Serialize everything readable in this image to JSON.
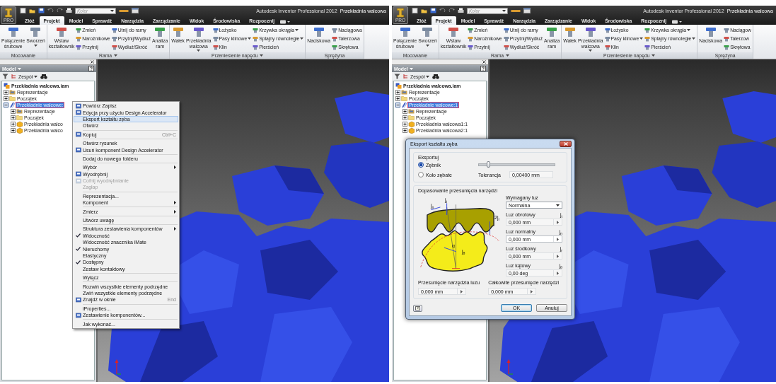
{
  "screens": [
    {
      "title_bar": {
        "app_badge": "PRO",
        "color_placeholder": "Kolor",
        "product": "Autodesk Inventor Professional 2012",
        "document": "Przekładnia walcowa"
      },
      "tabs": [
        {
          "label": "Złóż",
          "selected": false
        },
        {
          "label": "Projekt",
          "selected": true
        },
        {
          "label": "Model",
          "selected": false
        },
        {
          "label": "Sprawdź",
          "selected": false
        },
        {
          "label": "Narzędzia",
          "selected": false
        },
        {
          "label": "Zarządzanie",
          "selected": false
        },
        {
          "label": "Widok",
          "selected": false
        },
        {
          "label": "Środowiska",
          "selected": false
        },
        {
          "label": "Rozpocznij",
          "selected": false
        }
      ],
      "ribbon": [
        {
          "label": "Mocowanie",
          "menu": false,
          "tools": [
            {
              "kind": "large",
              "label": "Połączenie śrubowe",
              "dropdown": false
            },
            {
              "kind": "large",
              "label": "Sworzeń",
              "dropdown": true
            }
          ]
        },
        {
          "label": "Rama",
          "menu": true,
          "tools": [
            {
              "kind": "large",
              "label": "Wstaw kształtownik",
              "dropdown": false
            },
            {
              "kind": "column",
              "items": [
                {
                  "label": "Zmień",
                  "dropdown": false
                },
                {
                  "label": "Narożnikowe",
                  "dropdown": false
                },
                {
                  "label": "Przytnij",
                  "dropdown": false
                }
              ]
            },
            {
              "kind": "column",
              "items": [
                {
                  "label": "Utnij do ramy",
                  "dropdown": false
                },
                {
                  "label": "Przytnij/Wydłuż",
                  "dropdown": false
                },
                {
                  "label": "Wydłuż/Skróć",
                  "dropdown": false
                }
              ]
            },
            {
              "kind": "large",
              "label": "Analiza ram",
              "dropdown": false
            }
          ]
        },
        {
          "label": "Przeniesienie napędu",
          "menu": true,
          "tools": [
            {
              "kind": "large",
              "label": "Wałek",
              "dropdown": false
            },
            {
              "kind": "large",
              "label": "Przekładnia walcowa",
              "dropdown": true
            },
            {
              "kind": "column",
              "items": [
                {
                  "label": "Łożysko",
                  "dropdown": false
                },
                {
                  "label": "Pasy klinowe",
                  "dropdown": true
                },
                {
                  "label": "Klin",
                  "dropdown": false
                }
              ]
            },
            {
              "kind": "column",
              "items": [
                {
                  "label": "Krzywka okrągła",
                  "dropdown": true
                },
                {
                  "label": "Splajny równoległe",
                  "dropdown": true
                },
                {
                  "label": "Pierścień",
                  "dropdown": false
                }
              ]
            }
          ]
        },
        {
          "label": "Sprężyna",
          "menu": false,
          "tools": [
            {
              "kind": "large",
              "label": "Naciskowa",
              "dropdown": false
            },
            {
              "kind": "column",
              "items": [
                {
                  "label": "Naciągowa",
                  "dropdown": false
                },
                {
                  "label": "Talerzowa",
                  "dropdown": false
                },
                {
                  "label": "Skrętowa",
                  "dropdown": false
                }
              ]
            }
          ]
        }
      ],
      "browser": {
        "title": "Model",
        "filter": "Zespół",
        "tree": [
          {
            "label": "Przekładnia walcowa.iam",
            "kind": "assembly",
            "selected": false,
            "children": [
              {
                "label": "Reprezentacje",
                "kind": "representations",
                "selected": false,
                "expanded": false
              },
              {
                "label": "Początek",
                "kind": "origin",
                "selected": false,
                "expanded": false
              },
              {
                "label": "Przekładnie walcowe:",
                "kind": "gear-set",
                "selected": true,
                "expanded": true,
                "children": [
                  {
                    "label": "Reprezentacje",
                    "kind": "representations",
                    "selected": false,
                    "expanded": false
                  },
                  {
                    "label": "Początek",
                    "kind": "origin",
                    "selected": false,
                    "expanded": false
                  },
                  {
                    "label": "Przekładnia walco",
                    "kind": "part",
                    "selected": false,
                    "expanded": false
                  },
                  {
                    "label": "Przekładnia walco",
                    "kind": "part",
                    "selected": false,
                    "expanded": false
                  }
                ]
              }
            ]
          }
        ]
      },
      "context_menu": {
        "groups": [
          [
            {
              "label": "Powtórz Zapisz",
              "icon": true,
              "checked": false,
              "disabled": false,
              "selected": false,
              "submenu": false
            },
            {
              "label": "Edycja przy użyciu Design Accelerator",
              "icon": true,
              "checked": false,
              "disabled": false,
              "selected": false,
              "submenu": false
            },
            {
              "label": "Eksport kształtu zęba",
              "icon": false,
              "checked": false,
              "disabled": false,
              "selected": true,
              "submenu": false
            },
            {
              "label": "Otwórz",
              "icon": false,
              "checked": false,
              "disabled": false,
              "selected": false,
              "submenu": false
            }
          ],
          [
            {
              "label": "Kopiuj",
              "shortcut": "Ctrl+C",
              "icon": true,
              "checked": false,
              "disabled": false,
              "selected": false,
              "submenu": false
            }
          ],
          [
            {
              "label": "Otwórz rysunek",
              "icon": false,
              "checked": false,
              "disabled": false,
              "selected": false,
              "submenu": false
            },
            {
              "label": "Usuń komponent Design Accelerator",
              "icon": true,
              "checked": false,
              "disabled": false,
              "selected": false,
              "submenu": false
            }
          ],
          [
            {
              "label": "Dodaj do nowego folderu",
              "icon": false,
              "checked": false,
              "disabled": false,
              "selected": false,
              "submenu": false
            }
          ],
          [
            {
              "label": "Wybór",
              "icon": false,
              "checked": false,
              "disabled": false,
              "selected": false,
              "submenu": true
            },
            {
              "label": "Wyodrębnij",
              "icon": true,
              "checked": false,
              "disabled": false,
              "selected": false,
              "submenu": false
            },
            {
              "label": "Cofnij wyodrębnianie",
              "icon": true,
              "checked": false,
              "disabled": true,
              "selected": false,
              "submenu": false
            },
            {
              "label": "Zagłap",
              "icon": false,
              "checked": false,
              "disabled": true,
              "selected": false,
              "submenu": false
            }
          ],
          [
            {
              "label": "Reprezentacja...",
              "icon": false,
              "checked": false,
              "disabled": false,
              "selected": false,
              "submenu": false
            },
            {
              "label": "Komponent",
              "icon": false,
              "checked": false,
              "disabled": false,
              "selected": false,
              "submenu": true
            }
          ],
          [
            {
              "label": "Zmierz",
              "icon": false,
              "checked": false,
              "disabled": false,
              "selected": false,
              "submenu": true
            }
          ],
          [
            {
              "label": "Utwórz uwagę",
              "icon": false,
              "checked": false,
              "disabled": false,
              "selected": false,
              "submenu": false
            }
          ],
          [
            {
              "label": "Struktura zestawienia komponentów",
              "icon": false,
              "checked": false,
              "disabled": false,
              "selected": false,
              "submenu": true
            },
            {
              "label": "Widoczność",
              "icon": false,
              "checked": true,
              "disabled": false,
              "selected": false,
              "submenu": false
            },
            {
              "label": "Widoczność znacznika iMate",
              "icon": false,
              "checked": false,
              "disabled": false,
              "selected": false,
              "submenu": false
            },
            {
              "label": "Nieruchomy",
              "icon": false,
              "checked": true,
              "disabled": false,
              "selected": false,
              "submenu": false
            },
            {
              "label": "Elastyczny",
              "icon": false,
              "checked": false,
              "disabled": false,
              "selected": false,
              "submenu": false
            },
            {
              "label": "Dostępny",
              "icon": false,
              "checked": true,
              "disabled": false,
              "selected": false,
              "submenu": false
            },
            {
              "label": "Zestaw kontaktowy",
              "icon": false,
              "checked": false,
              "disabled": false,
              "selected": false,
              "submenu": false
            }
          ],
          [
            {
              "label": "Wyłącz",
              "icon": false,
              "checked": false,
              "disabled": false,
              "selected": false,
              "submenu": false
            }
          ],
          [
            {
              "label": "Rozwiń wszystkie elementy podrzędne",
              "icon": false,
              "checked": false,
              "disabled": false,
              "selected": false,
              "submenu": false
            },
            {
              "label": "Zwiń wszystkie elementy podrzędne",
              "icon": false,
              "checked": false,
              "disabled": false,
              "selected": false,
              "submenu": false
            },
            {
              "label": "Znajdź w oknie",
              "shortcut": "End",
              "icon": true,
              "checked": false,
              "disabled": false,
              "selected": false,
              "submenu": false
            }
          ],
          [
            {
              "label": "iProperties...",
              "icon": false,
              "checked": false,
              "disabled": false,
              "selected": false,
              "submenu": false
            },
            {
              "label": "Zestawienie komponentów...",
              "icon": true,
              "checked": false,
              "disabled": false,
              "selected": false,
              "submenu": false
            }
          ],
          [
            {
              "label": "Jak wykonać...",
              "icon": false,
              "checked": false,
              "disabled": false,
              "selected": false,
              "submenu": false
            }
          ]
        ]
      }
    },
    {
      "title_bar": {
        "app_badge": "PRO",
        "color_placeholder": "Kolor",
        "product": "Autodesk Inventor Professional 2012",
        "document": "Przekładnia walcowa"
      },
      "tabs": [
        {
          "label": "Złóż",
          "selected": false
        },
        {
          "label": "Projekt",
          "selected": true
        },
        {
          "label": "Model",
          "selected": false
        },
        {
          "label": "Sprawdź",
          "selected": false
        },
        {
          "label": "Narzędzia",
          "selected": false
        },
        {
          "label": "Zarządzanie",
          "selected": false
        },
        {
          "label": "Widok",
          "selected": false
        },
        {
          "label": "Środowiska",
          "selected": false
        },
        {
          "label": "Rozpocznij",
          "selected": false
        }
      ],
      "ribbon": [
        {
          "label": "Mocowanie",
          "menu": false,
          "tools": [
            {
              "kind": "large",
              "label": "Połączenie śrubowe",
              "dropdown": false
            },
            {
              "kind": "large",
              "label": "Sworzeń",
              "dropdown": true
            }
          ]
        },
        {
          "label": "Rama",
          "menu": true,
          "tools": [
            {
              "kind": "large",
              "label": "Wstaw kształtownik",
              "dropdown": false
            },
            {
              "kind": "column",
              "items": [
                {
                  "label": "Zmień",
                  "dropdown": false
                },
                {
                  "label": "Narożnikowe",
                  "dropdown": false
                },
                {
                  "label": "Przytnij",
                  "dropdown": false
                }
              ]
            },
            {
              "kind": "column",
              "items": [
                {
                  "label": "Utnij do ramy",
                  "dropdown": false
                },
                {
                  "label": "Przytnij/Wydłuż",
                  "dropdown": false
                },
                {
                  "label": "Wydłuż/Skróć",
                  "dropdown": false
                }
              ]
            },
            {
              "kind": "large",
              "label": "Analiza ram",
              "dropdown": false
            }
          ]
        },
        {
          "label": "Przeniesienie napędu",
          "menu": true,
          "tools": [
            {
              "kind": "large",
              "label": "Wałek",
              "dropdown": false
            },
            {
              "kind": "large",
              "label": "Przekładnia walcowa",
              "dropdown": true
            },
            {
              "kind": "column",
              "items": [
                {
                  "label": "Łożysko",
                  "dropdown": false
                },
                {
                  "label": "Pasy klinowe",
                  "dropdown": true
                },
                {
                  "label": "Klin",
                  "dropdown": false
                }
              ]
            },
            {
              "kind": "column",
              "items": [
                {
                  "label": "Krzywka okrągła",
                  "dropdown": true
                },
                {
                  "label": "Splajny równoległe",
                  "dropdown": true
                },
                {
                  "label": "Pierścień",
                  "dropdown": false
                }
              ]
            }
          ]
        },
        {
          "label": "Sprężyna",
          "menu": false,
          "tools": [
            {
              "kind": "large",
              "label": "Naciskowa",
              "dropdown": false
            },
            {
              "kind": "column",
              "items": [
                {
                  "label": "Naciągow",
                  "dropdown": false
                },
                {
                  "label": "Talerzow",
                  "dropdown": false
                },
                {
                  "label": "Skrętowa",
                  "dropdown": false
                }
              ]
            }
          ]
        }
      ],
      "browser": {
        "title": "Model",
        "filter": "Zespół",
        "tree": [
          {
            "label": "Przekładnia walcowa.iam",
            "kind": "assembly",
            "selected": false,
            "children": [
              {
                "label": "Reprezentacje",
                "kind": "representations",
                "selected": false,
                "expanded": false
              },
              {
                "label": "Początek",
                "kind": "origin",
                "selected": false,
                "expanded": false
              },
              {
                "label": "Przekładnie walcowe:1",
                "kind": "gear-set",
                "selected": true,
                "expanded": true,
                "children": [
                  {
                    "label": "Reprezentacje",
                    "kind": "representations",
                    "selected": false,
                    "expanded": false
                  },
                  {
                    "label": "Początek",
                    "kind": "origin",
                    "selected": false,
                    "expanded": false
                  },
                  {
                    "label": "Przekładnia walcowa1:1",
                    "kind": "part",
                    "selected": false,
                    "expanded": false
                  },
                  {
                    "label": "Przekładnia walcowa2:1",
                    "kind": "part",
                    "selected": false,
                    "expanded": false
                  }
                ]
              }
            ]
          }
        ]
      },
      "dialog": {
        "title": "Eksport kształtu zęba",
        "export": {
          "label": "Eksportuj",
          "options": [
            {
              "label": "Zębnik",
              "selected": true
            },
            {
              "label": "Koło zębate",
              "selected": false
            }
          ],
          "slider": {
            "level": 0.12
          },
          "tolerance": {
            "label": "Tolerancja",
            "value": "0,00400 mm"
          }
        },
        "fit": {
          "label": "Dopasowanie przesunięcia narzędzi",
          "diagram_labels": [
            "j$_{n}$",
            "j$_{t}$",
            "2j$_{r}$",
            "α",
            "j$_{θ}$"
          ],
          "required": {
            "label": "Wymagany luz",
            "value": "Normalna"
          },
          "fields": [
            {
              "label": "Luz obrotowy",
              "symbol": "j$_{t}$",
              "value": "0,000 mm",
              "disabled": true
            },
            {
              "label": "Luz normalny",
              "symbol": "j$_{n}$",
              "value": "0,000 mm",
              "disabled": false
            },
            {
              "label": "Luz środkowy",
              "symbol": "j$_{r}$",
              "value": "0,000 mm",
              "disabled": true
            },
            {
              "label": "Luz kątowy",
              "symbol": "j$_{θ}$",
              "value": "0,00 deg",
              "disabled": true
            }
          ],
          "tool_shift": {
            "label": "Przesunięcie narzędzia luzu",
            "value": "0,000 mm",
            "disabled": true
          },
          "total_shift": {
            "label": "Całkowite przesunięcie narzędzi",
            "value": "0,000 mm",
            "disabled": true
          }
        },
        "buttons": [
          {
            "label": "OK",
            "default": true
          },
          {
            "label": "Anuluj",
            "default": false
          }
        ]
      }
    }
  ]
}
